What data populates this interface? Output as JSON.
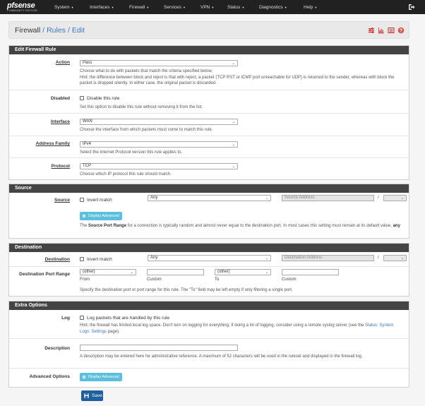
{
  "brand": {
    "name": "sense",
    "prefix": "pf",
    "edition": "COMMUNITY EDITION"
  },
  "nav": [
    "System",
    "Interfaces",
    "Firewall",
    "Services",
    "VPN",
    "Status",
    "Diagnostics",
    "Help"
  ],
  "breadcrumb": {
    "root": "Firewall",
    "level1": "Rules",
    "level2": "Edit"
  },
  "sections": {
    "edit": "Edit Firewall Rule",
    "source": "Source",
    "destination": "Destination",
    "extra": "Extra Options"
  },
  "action": {
    "label": "Action",
    "value": "Pass",
    "help1": "Choose what to do with packets that match the criteria specified below.",
    "help2": "Hint: the difference between block and reject is that with reject, a packet (TCP RST or ICMP port unreachable for UDP) is returned to the sender, whereas with block the packet is dropped silently. In either case, the original packet is discarded."
  },
  "disabled": {
    "label": "Disabled",
    "checkbox": "Disable this rule",
    "help": "Set this option to disable this rule without removing it from the list."
  },
  "interface": {
    "label": "Interface",
    "value": "WAN",
    "help": "Choose the interface from which packets must come to match this rule."
  },
  "family": {
    "label": "Address Family",
    "value": "IPv4",
    "help": "Select the Internet Protocol version this rule applies to."
  },
  "protocol": {
    "label": "Protocol",
    "value": "TCP",
    "help": "Choose which IP protocol this rule should match."
  },
  "source": {
    "label": "Source",
    "invert": "Invert match",
    "type": "Any",
    "address_placeholder": "Source Address",
    "slash": "/",
    "adv_button": "Display Advanced",
    "help_pre": "The ",
    "help_bold": "Source Port Range",
    "help_mid": " for a connection is typically random and almost never equal to the destination port. In most cases this setting must remain at its default value, ",
    "help_bold2": "any"
  },
  "destination": {
    "label": "Destination",
    "invert": "Invert match",
    "type": "Any",
    "address_placeholder": "Destination Address",
    "slash": "/",
    "port_label": "Destination Port Range",
    "from_value": "(other)",
    "to_value": "(other)",
    "from": "From",
    "custom1": "Custom",
    "to": "To",
    "custom2": "Custom",
    "help": "Specify the destination port or port range for this rule. The \"To\" field may be left empty if only filtering a single port."
  },
  "log": {
    "label": "Log",
    "checkbox": "Log packets that are handled by this rule",
    "help_pre": "Hint: the firewall has limited local log space. Don't turn on logging for everything. If doing a lot of logging, consider using a remote syslog server (see the ",
    "help_link": "Status: System Logs: Settings",
    "help_post": " page)."
  },
  "description": {
    "label": "Description",
    "value": "",
    "help": "A description may be entered here for administrative reference. A maximum of 52 characters will be used in the ruleset and displayed in the firewall log."
  },
  "advanced": {
    "label": "Advanced Options",
    "button": "Display Advanced"
  },
  "save": "Save",
  "colors": {
    "navbar": "#212121",
    "panel_head": "#444444",
    "link": "#3a78c3",
    "info": "#5bc0de",
    "primary": "#1e5f9f",
    "danger": "#d9534f"
  }
}
